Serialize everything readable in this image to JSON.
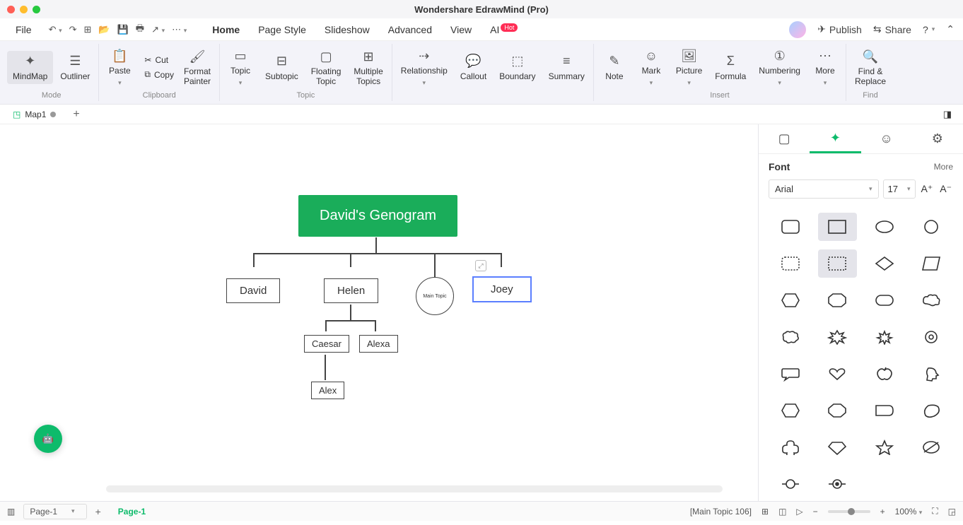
{
  "app_title": "Wondershare EdrawMind (Pro)",
  "file_menu": "File",
  "menu_tabs": {
    "home": "Home",
    "page_style": "Page Style",
    "slideshow": "Slideshow",
    "advanced": "Advanced",
    "view": "View",
    "ai": "AI",
    "hot": "Hot"
  },
  "right_menu": {
    "publish": "Publish",
    "share": "Share"
  },
  "ribbon": {
    "mode": {
      "mindmap": "MindMap",
      "outliner": "Outliner",
      "group": "Mode"
    },
    "clipboard": {
      "paste": "Paste",
      "cut": "Cut",
      "copy": "Copy",
      "format_painter": "Format\nPainter",
      "group": "Clipboard"
    },
    "topic": {
      "topic": "Topic",
      "subtopic": "Subtopic",
      "floating": "Floating\nTopic",
      "multiple": "Multiple\nTopics",
      "group": "Topic"
    },
    "rel": {
      "relationship": "Relationship",
      "callout": "Callout",
      "boundary": "Boundary",
      "summary": "Summary"
    },
    "insert": {
      "note": "Note",
      "mark": "Mark",
      "picture": "Picture",
      "formula": "Formula",
      "numbering": "Numbering",
      "more": "More",
      "group": "Insert"
    },
    "find": {
      "find": "Find &\nReplace",
      "group": "Find"
    }
  },
  "doc_tab": "Map1",
  "diagram": {
    "root": "David's Genogram",
    "david": "David",
    "helen": "Helen",
    "main": "Main Topic",
    "joey": "Joey",
    "caesar": "Caesar",
    "alexa": "Alexa",
    "alex": "Alex"
  },
  "sidepanel": {
    "font_label": "Font",
    "more": "More",
    "font_family": "Arial",
    "font_size": "17"
  },
  "status": {
    "page_sel": "Page-1",
    "page_cur": "Page-1",
    "selection": "[Main Topic 106]",
    "zoom": "100%"
  }
}
